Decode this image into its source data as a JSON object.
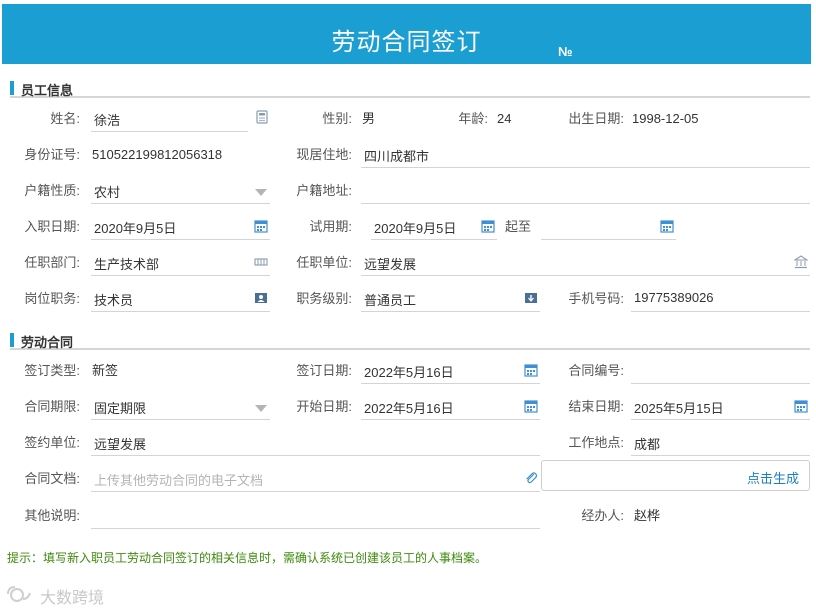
{
  "header": {
    "title": "劳动合同签订",
    "no_label": "№"
  },
  "sections": {
    "employee": "员工信息",
    "contract": "劳动合同"
  },
  "employee": {
    "name_label": "姓名:",
    "name": "徐浩",
    "gender_label": "性别:",
    "gender": "男",
    "age_label": "年龄:",
    "age": "24",
    "birth_label": "出生日期:",
    "birth": "1998-12-05",
    "idcard_label": "身份证号:",
    "idcard": "510522199812056318",
    "residence_label": "现居住地:",
    "residence": "四川成都市",
    "hukou_type_label": "户籍性质:",
    "hukou_type": "农村",
    "hukou_addr_label": "户籍地址:",
    "hukou_addr": "",
    "entry_date_label": "入职日期:",
    "entry_date": "2020年9月5日",
    "probation_label": "试用期:",
    "probation_start": "2020年9月5日",
    "to_label": "起至",
    "probation_end": "",
    "dept_label": "任职部门:",
    "dept": "生产技术部",
    "unit_label": "任职单位:",
    "unit": "远望发展",
    "position_label": "岗位职务:",
    "position": "技术员",
    "level_label": "职务级别:",
    "level": "普通员工",
    "phone_label": "手机号码:",
    "phone": "19775389026"
  },
  "contract": {
    "sign_type_label": "签订类型:",
    "sign_type": "新签",
    "sign_date_label": "签订日期:",
    "sign_date": "2022年5月16日",
    "number_label": "合同编号:",
    "number": "",
    "term_label": "合同期限:",
    "term": "固定期限",
    "start_label": "开始日期:",
    "start": "2022年5月16日",
    "end_label": "结束日期:",
    "end": "2025年5月15日",
    "sign_unit_label": "签约单位:",
    "sign_unit": "远望发展",
    "workplace_label": "工作地点:",
    "workplace": "成都",
    "doc_label": "合同文档:",
    "doc_placeholder": "上传其他劳动合同的电子文档",
    "generate_button": "点击生成",
    "other_label": "其他说明:",
    "other": "",
    "handler_label": "经办人:",
    "handler": "赵桦"
  },
  "hint": "提示：填写新入职员工劳动合同签订的相关信息时，需确认系统已创建该员工的人事档案。",
  "watermark": "大数跨境",
  "colors": {
    "accent": "#1b9fd3",
    "hint": "#3d8a0c",
    "link": "#1b7fc4"
  },
  "icons": [
    "calculator-icon",
    "dropdown-arrow-icon",
    "calendar-icon",
    "org-chart-icon",
    "bank-icon",
    "id-card-icon",
    "download-icon",
    "paperclip-icon"
  ]
}
